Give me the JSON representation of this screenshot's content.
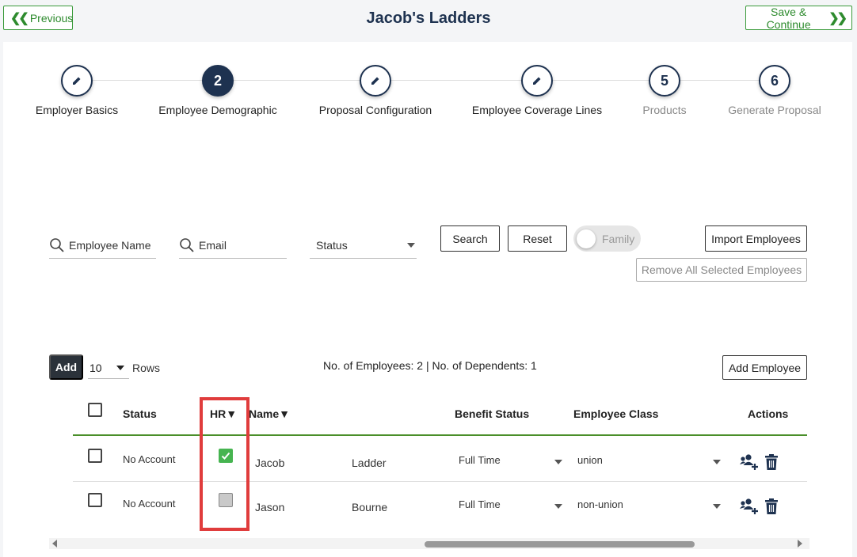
{
  "header": {
    "title": "Jacob's Ladders",
    "previous_label": "Previous",
    "save_continue_label": "Save & Continue"
  },
  "stepper": [
    {
      "label": "Employer Basics",
      "marker": "edit-icon",
      "state": "done"
    },
    {
      "label": "Employee Demographic",
      "marker": "2",
      "state": "active"
    },
    {
      "label": "Proposal Configuration",
      "marker": "edit-icon",
      "state": "done"
    },
    {
      "label": "Employee Coverage Lines",
      "marker": "edit-icon",
      "state": "done"
    },
    {
      "label": "Products",
      "marker": "5",
      "state": "pending"
    },
    {
      "label": "Generate Proposal",
      "marker": "6",
      "state": "pending"
    }
  ],
  "filters": {
    "employee_name_placeholder": "Employee Name",
    "email_placeholder": "Email",
    "status_label": "Status",
    "search_label": "Search",
    "reset_label": "Reset",
    "family_toggle_label": "Family",
    "import_label": "Import Employees",
    "remove_all_label": "Remove All Selected Employees"
  },
  "table_controls": {
    "add_label": "Add",
    "rows_value": "10",
    "rows_label": "Rows",
    "counts_text": "No. of Employees: 2 | No. of Dependents: 1",
    "add_employee_label": "Add Employee"
  },
  "columns": {
    "status": "Status",
    "hr": "HR▼",
    "name": "Name▼",
    "benefit_status": "Benefit Status",
    "employee_class": "Employee Class",
    "actions": "Actions"
  },
  "rows": [
    {
      "status": "No Account",
      "hr": true,
      "first": "Jacob",
      "last": "Ladder",
      "benefit_status": "Full Time",
      "employee_class": "union"
    },
    {
      "status": "No Account",
      "hr": false,
      "first": "Jason",
      "last": "Bourne",
      "benefit_status": "Full Time",
      "employee_class": "non-union"
    }
  ],
  "colors": {
    "brand_navy": "#1e3250",
    "accent_green": "#46b450",
    "highlight_red": "#e03c3c"
  }
}
